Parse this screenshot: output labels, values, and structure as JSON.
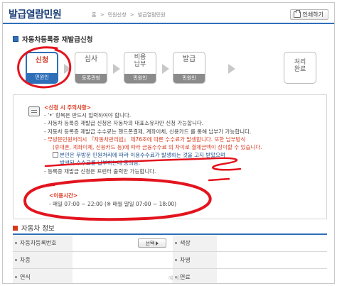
{
  "header": {
    "title": "발급열람민원",
    "breadcrumb": [
      "홈",
      ">",
      "민원신청",
      ">",
      "발급열람민원"
    ],
    "print_label": "인쇄하기"
  },
  "section_title": "자동차등록증 재발급신청",
  "steps": [
    {
      "label": "신청",
      "sub": "민원인",
      "active": true
    },
    {
      "label": "심사",
      "sub": "등록관청",
      "active": false
    },
    {
      "label": "비용납부",
      "line1": "비용",
      "line2": "납부",
      "sub": "민원인",
      "active": false
    },
    {
      "label": "발급",
      "sub": "민원인",
      "active": false
    },
    {
      "label": "처리완료",
      "line1": "처리",
      "line2": "완료",
      "sub": "",
      "active": false
    }
  ],
  "notice": {
    "heading": "<신청 시 주의사항>",
    "lines": [
      "- '•' 항목은 반드시 입력하여야 합니다.",
      "- 자동차 등록증 재발급 신청은 자동차의 대표소유자만 신청 가능합니다.",
      "- 자동차 등록증 재발급 수수료는 핸드폰결제, 계좌이체, 신용카드 를 통해 납부가 가능합니다.",
      "- 무방문민원처리시 『자동차관리법』 제76조에 따른 수수료가 발생합니다. 또한 납부방식",
      "(휴대폰, 계좌이체, 신용카드 등)에 따라 금융수수료 의 차이로 결제금액이 상이할 수 있습니다.",
      "본인은 무방문 민원처리에 따라 이용수수료가 발생하는 것을 고지 받았으며",
      "발생된 수수료를 납부하는데 동의함.",
      "- 등록증 재발급 신청은 프린터 출력만 가능합니다."
    ]
  },
  "usage": {
    "heading": "<이용시간>",
    "line": "- 매일 07:00 ~ 22:00 (※ 매월 말일 07:00 ~ 18:00)"
  },
  "vehicle": {
    "title": "자동차 정보",
    "fields": {
      "reg_no": "자동차등록번호",
      "select_label": "선택",
      "color": "색상",
      "model": "차종",
      "name": "차명",
      "year": "연식",
      "fuel": "연료"
    }
  },
  "watermark": "예 제보"
}
